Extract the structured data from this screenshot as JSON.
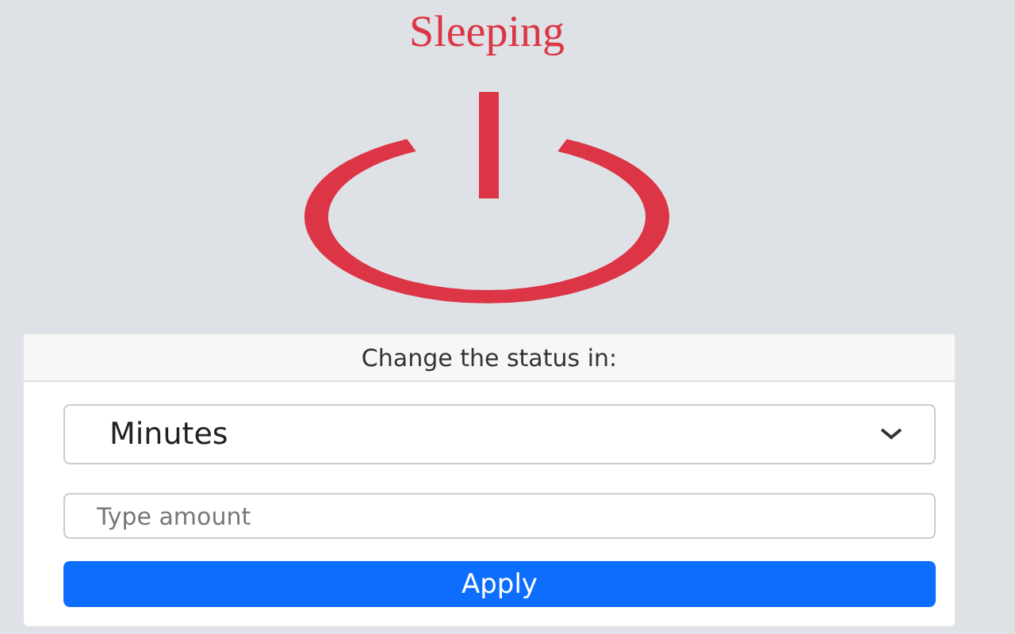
{
  "status": {
    "title": "Sleeping"
  },
  "card": {
    "header": "Change the status in:",
    "unit_select": {
      "value": "Minutes"
    },
    "amount": {
      "placeholder": "Type amount"
    },
    "apply_button": {
      "label": "Apply"
    }
  }
}
